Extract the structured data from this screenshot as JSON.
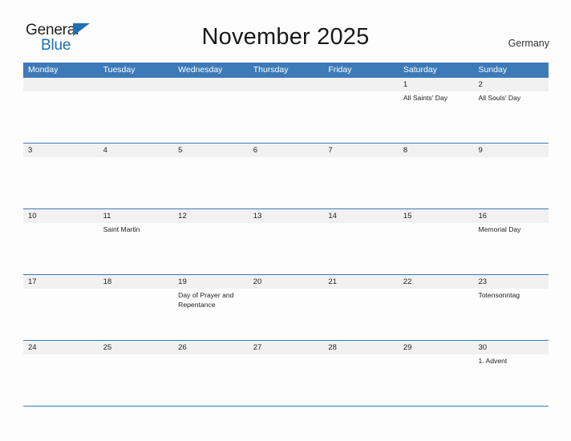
{
  "brand": {
    "line1": "General",
    "line2": "Blue",
    "triangle_color": "#1f6fb4"
  },
  "header": {
    "title": "November 2025",
    "region": "Germany",
    "accent_color": "#3d7ab8",
    "date_band_color": "#f1f1f1"
  },
  "calendar": {
    "weekdays": [
      "Monday",
      "Tuesday",
      "Wednesday",
      "Thursday",
      "Friday",
      "Saturday",
      "Sunday"
    ],
    "weeks": [
      {
        "days": [
          {
            "date": "",
            "event": ""
          },
          {
            "date": "",
            "event": ""
          },
          {
            "date": "",
            "event": ""
          },
          {
            "date": "",
            "event": ""
          },
          {
            "date": "",
            "event": ""
          },
          {
            "date": "1",
            "event": "All Saints' Day"
          },
          {
            "date": "2",
            "event": "All Souls' Day"
          }
        ]
      },
      {
        "days": [
          {
            "date": "3",
            "event": ""
          },
          {
            "date": "4",
            "event": ""
          },
          {
            "date": "5",
            "event": ""
          },
          {
            "date": "6",
            "event": ""
          },
          {
            "date": "7",
            "event": ""
          },
          {
            "date": "8",
            "event": ""
          },
          {
            "date": "9",
            "event": ""
          }
        ]
      },
      {
        "days": [
          {
            "date": "10",
            "event": ""
          },
          {
            "date": "11",
            "event": "Saint Martin"
          },
          {
            "date": "12",
            "event": ""
          },
          {
            "date": "13",
            "event": ""
          },
          {
            "date": "14",
            "event": ""
          },
          {
            "date": "15",
            "event": ""
          },
          {
            "date": "16",
            "event": "Memorial Day"
          }
        ]
      },
      {
        "days": [
          {
            "date": "17",
            "event": ""
          },
          {
            "date": "18",
            "event": ""
          },
          {
            "date": "19",
            "event": "Day of Prayer and Repentance"
          },
          {
            "date": "20",
            "event": ""
          },
          {
            "date": "21",
            "event": ""
          },
          {
            "date": "22",
            "event": ""
          },
          {
            "date": "23",
            "event": "Totensonntag"
          }
        ]
      },
      {
        "days": [
          {
            "date": "24",
            "event": ""
          },
          {
            "date": "25",
            "event": ""
          },
          {
            "date": "26",
            "event": ""
          },
          {
            "date": "27",
            "event": ""
          },
          {
            "date": "28",
            "event": ""
          },
          {
            "date": "29",
            "event": ""
          },
          {
            "date": "30",
            "event": "1. Advent"
          }
        ]
      }
    ]
  }
}
